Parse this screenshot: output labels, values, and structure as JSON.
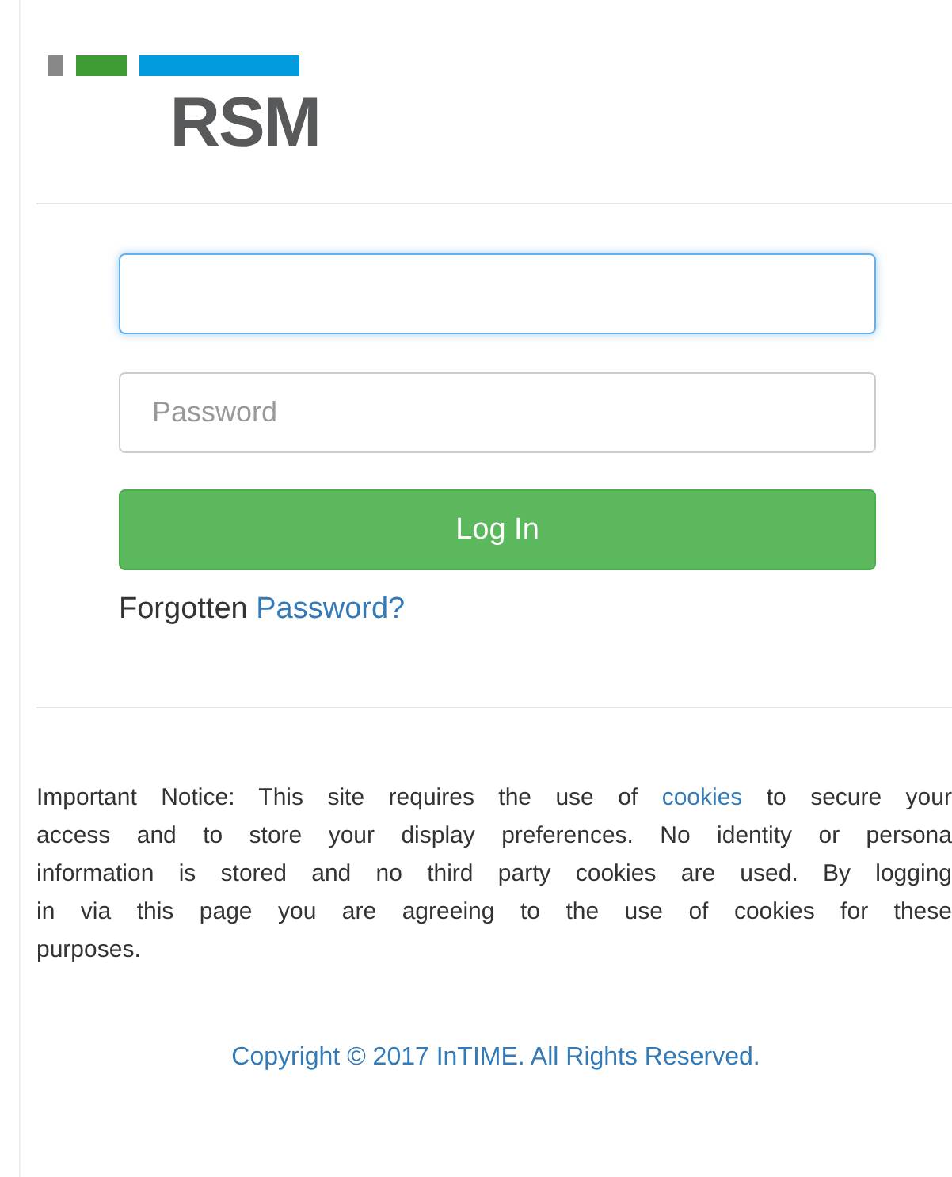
{
  "logo": {
    "text": "RSM"
  },
  "login": {
    "username": {
      "focused": true
    },
    "password": {
      "placeholder": "Password",
      "focused": false
    },
    "button": "Log In",
    "forgot": {
      "text": "Forgotten",
      "link": "Password?"
    }
  },
  "notice": {
    "lines": [
      {
        "text": "Important Notice: This site requires the use of ",
        "link": "cookies",
        "after": " to secure your"
      },
      {
        "text": "access and to store your display preferences. No identity or persona"
      },
      {
        "text": "information is stored and no third party cookies are used. By logging"
      },
      {
        "text": "in via this page you are agreeing to the use of cookies for these"
      },
      {
        "text": "purposes."
      }
    ]
  },
  "footer": {
    "copyright": "Copyright © 2017 InTIME. All Rights Reserved."
  }
}
